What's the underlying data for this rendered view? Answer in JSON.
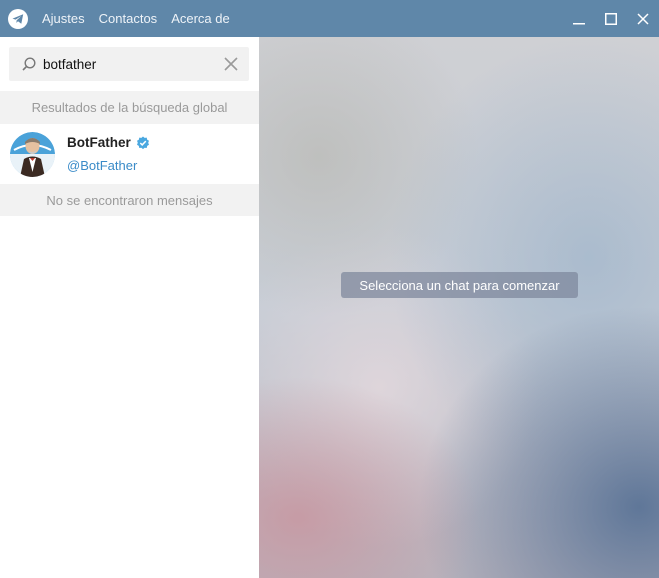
{
  "titlebar": {
    "menu": [
      "Ajustes",
      "Contactos",
      "Acerca de"
    ],
    "app_icon": "telegram-paper-plane-icon",
    "controls": [
      "minimize-icon",
      "maximize-icon",
      "close-icon"
    ],
    "accent": "#5f87a9"
  },
  "search": {
    "value": "botfather",
    "icon": "search-icon",
    "clear_icon": "clear-icon"
  },
  "global_results": {
    "header": "Resultados de la búsqueda global",
    "items": [
      {
        "name": "BotFather",
        "handle": "@BotFather",
        "verified": true,
        "avatar": "botfather-avatar"
      }
    ]
  },
  "messages": {
    "empty_text": "No se encontraron mensajes"
  },
  "main": {
    "placeholder": "Selecciona un chat para comenzar"
  },
  "colors": {
    "handle": "#3a8bc8",
    "section_bg": "#f2f2f2",
    "verified": "#4aa8e0"
  }
}
